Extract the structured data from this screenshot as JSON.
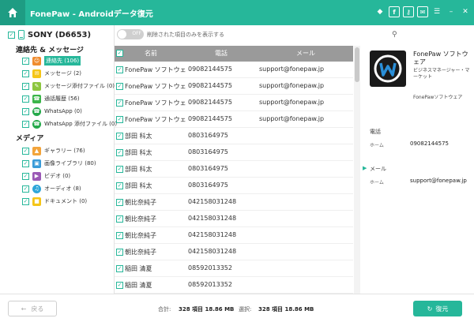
{
  "app": {
    "title": "FonePaw - Androidデータ復元"
  },
  "colors": {
    "accent": "#26b79a",
    "header_gray": "#9a9a9a"
  },
  "window_controls": [
    "diamond-icon",
    "facebook-icon",
    "key-icon",
    "feedback-icon",
    "menu-icon",
    "minimize-icon",
    "close-icon"
  ],
  "device": {
    "name": "SONY (D6653)"
  },
  "sidebar": {
    "contacts_section": "連絡先 & メッセージ",
    "contacts_items": [
      {
        "label": "連絡先 (106)",
        "icon": "contacts-icon"
      },
      {
        "label": "メッセージ (2)",
        "icon": "message-icon"
      },
      {
        "label": "メッセージ添付ファイル (0)",
        "icon": "attachment-icon"
      },
      {
        "label": "通話履歴 (56)",
        "icon": "call-log-icon"
      },
      {
        "label": "WhatsApp (0)",
        "icon": "whatsapp-icon"
      },
      {
        "label": "WhatsApp 添付ファイル (0)",
        "icon": "whatsapp-icon"
      }
    ],
    "media_section": "メディア",
    "media_items": [
      {
        "label": "ギャラリー (76)",
        "icon": "gallery-icon"
      },
      {
        "label": "画像ライブラリ (80)",
        "icon": "image-library-icon"
      },
      {
        "label": "ビデオ (0)",
        "icon": "video-icon"
      },
      {
        "label": "オーディオ (8)",
        "icon": "audio-icon"
      },
      {
        "label": "ドキュメント (0)",
        "icon": "document-icon"
      }
    ]
  },
  "toolbar": {
    "toggle_label": "OFF",
    "filter_label": "削除された項目のみを表示する",
    "search_placeholder": ""
  },
  "table": {
    "headers": {
      "name": "名前",
      "phone": "電話",
      "email": "メール"
    },
    "rows": [
      {
        "name": "FonePaw ソフトウェア",
        "phone": "09082144575",
        "email": "support@fonepaw.jp"
      },
      {
        "name": "FonePaw ソフトウェア",
        "phone": "09082144575",
        "email": "support@fonepaw.jp"
      },
      {
        "name": "FonePaw ソフトウェア",
        "phone": "09082144575",
        "email": "support@fonepaw.jp"
      },
      {
        "name": "FonePaw ソフトウェア",
        "phone": "09082144575",
        "email": "support@fonepaw.jp"
      },
      {
        "name": "部田 科太",
        "phone": "0803164975",
        "email": ""
      },
      {
        "name": "部田 科太",
        "phone": "0803164975",
        "email": ""
      },
      {
        "name": "部田 科太",
        "phone": "0803164975",
        "email": ""
      },
      {
        "name": "部田 科太",
        "phone": "0803164975",
        "email": ""
      },
      {
        "name": "朝比奈純子",
        "phone": "042158031248",
        "email": ""
      },
      {
        "name": "朝比奈純子",
        "phone": "042158031248",
        "email": ""
      },
      {
        "name": "朝比奈純子",
        "phone": "042158031248",
        "email": ""
      },
      {
        "name": "朝比奈純子",
        "phone": "042158031248",
        "email": ""
      },
      {
        "name": "稲田 清夏",
        "phone": "08592013352",
        "email": ""
      },
      {
        "name": "稲田 清夏",
        "phone": "08592013352",
        "email": ""
      }
    ]
  },
  "detail": {
    "name": "FonePaw ソフトウェア",
    "title": "ビジネスマネージャー・マーケット",
    "company": "FonePawソフトウェア",
    "phone_section": "電話",
    "phone_type": "ホーム",
    "phone_value": "09082144575",
    "email_section": "メール",
    "email_type": "ホーム",
    "email_value": "support@fonepaw.jp"
  },
  "footer": {
    "back_label": "戻る",
    "total_label": "合計:",
    "total_value": "328 項目 18.86 MB",
    "selected_label": "選択:",
    "selected_value": "328 項目 18.86 MB",
    "recover_label": "復元"
  }
}
